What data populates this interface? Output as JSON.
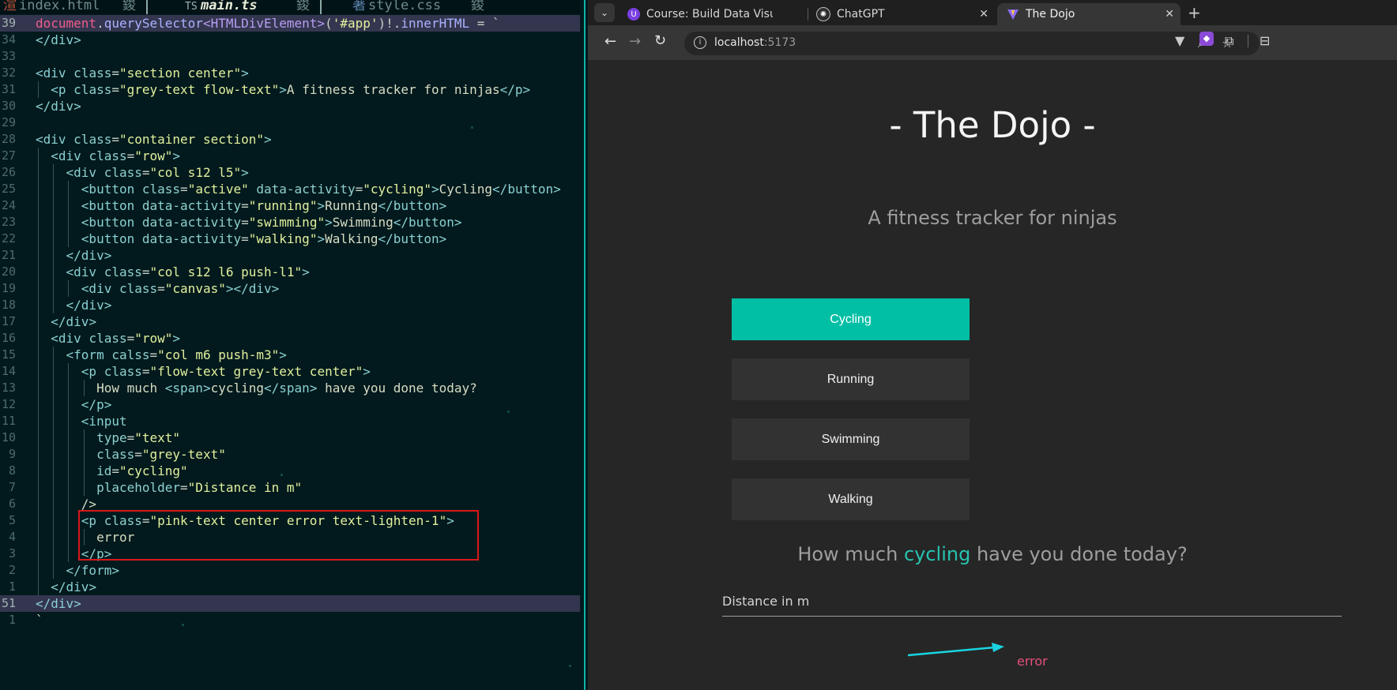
{
  "editor": {
    "tabs": [
      {
        "icon": "渲",
        "label": "index.html",
        "modified_marker": "鋑"
      },
      {
        "icon": "TS",
        "label": "main.ts",
        "modified_marker": "鋑"
      },
      {
        "icon": "著",
        "label": "style.css",
        "modified_marker": "鋑"
      }
    ],
    "line_numbers": [
      "39",
      "34",
      "33",
      "32",
      "31",
      "30",
      "29",
      "28",
      "27",
      "26",
      "25",
      "24",
      "23",
      "22",
      "21",
      "20",
      "19",
      "18",
      "17",
      "16",
      "15",
      "14",
      "13",
      "12",
      "11",
      "10",
      "9",
      "8",
      "7",
      "6",
      "5",
      "4",
      "3",
      "2",
      "1",
      "51",
      "1"
    ],
    "lines": [
      "document.querySelector<HTMLDivElement>('#app')!.innerHTML = `",
      "</div>",
      "",
      "<div class=\"section center\">",
      "  <p class=\"grey-text flow-text\">A fitness tracker for ninjas</p>",
      "</div>",
      "",
      "<div class=\"container section\">",
      "  <div class=\"row\">",
      "    <div class=\"col s12 l5\">",
      "      <button class=\"active\" data-activity=\"cycling\">Cycling</button>",
      "      <button data-activity=\"running\">Running</button>",
      "      <button data-activity=\"swimming\">Swimming</button>",
      "      <button data-activity=\"walking\">Walking</button>",
      "    </div>",
      "    <div class=\"col s12 l6 push-l1\">",
      "      <div class=\"canvas\"></div>",
      "    </div>",
      "  </div>",
      "  <div class=\"row\">",
      "    <form calss=\"col m6 push-m3\">",
      "      <p class=\"flow-text grey-text center\">",
      "        How much <span>cycling</span> have you done today?",
      "      </p>",
      "      <input",
      "        type=\"text\"",
      "        class=\"grey-text\"",
      "        id=\"cycling\"",
      "        placeholder=\"Distance in m\"",
      "      />",
      "      <p class=\"pink-text center error text-lighten-1\">",
      "        error",
      "      </p>",
      "    </form>",
      "  </div>",
      "</div>",
      "`"
    ]
  },
  "browser": {
    "tabs": [
      {
        "title": "Course: Build Data Visua",
        "close": "✕"
      },
      {
        "title": "ChatGPT",
        "close": "✕"
      },
      {
        "title": "The Dojo",
        "close": "✕"
      }
    ],
    "new_tab": "+",
    "address": {
      "host": "localhost",
      "port": ":5173"
    },
    "page": {
      "site_title": "- The Dojo -",
      "tagline": "A fitness tracker for ninjas",
      "activities": [
        "Cycling",
        "Running",
        "Swimming",
        "Walking"
      ],
      "active_activity": "Cycling",
      "question_prefix": "How much ",
      "question_activity": "cycling",
      "question_suffix": " have you done today?",
      "input_placeholder": "Distance in m",
      "error": "error"
    }
  },
  "colors": {
    "accent": "#00bfa5",
    "error": "#e64f7b",
    "annotation_box": "#d8181b",
    "annotation_arrow": "#19d3e0"
  }
}
